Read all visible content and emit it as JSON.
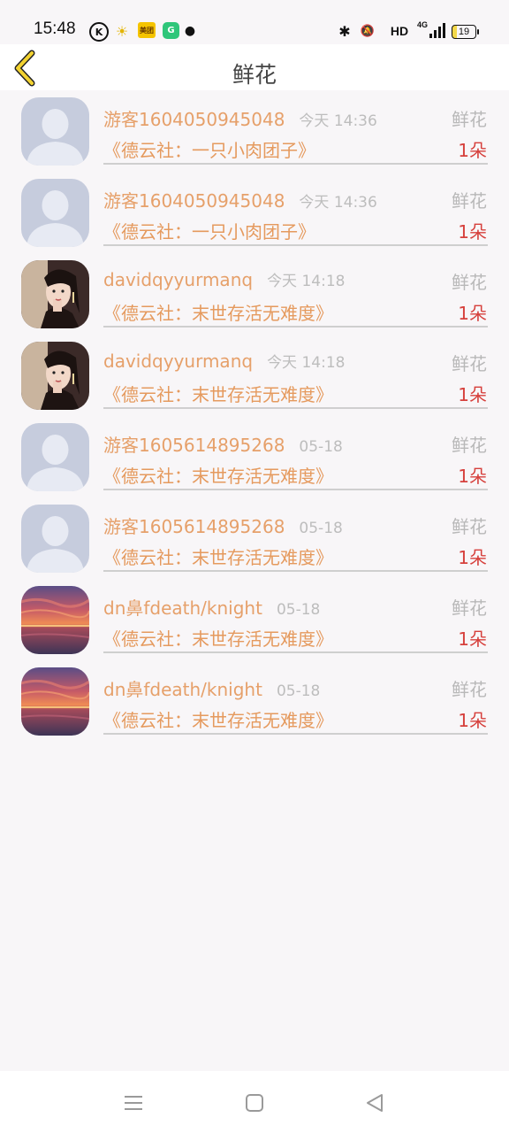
{
  "status_bar": {
    "time": "15:48",
    "icons": [
      "k-icon",
      "weather-icon",
      "app-icon",
      "app-icon",
      "dot-icon",
      "bluetooth-icon",
      "mute-icon",
      "hd-icon",
      "signal-icon",
      "battery-icon"
    ],
    "app1_label": "美团",
    "hd_label": "HD",
    "network_label": "4G",
    "battery_level": "19"
  },
  "header": {
    "title": "鲜花"
  },
  "list": [
    {
      "user": "游客1604050945048",
      "time": "今天 14:36",
      "type": "鲜花",
      "book": "《德云社：一只小肉团子》",
      "count": "1朵",
      "avatar": "default"
    },
    {
      "user": "游客1604050945048",
      "time": "今天 14:36",
      "type": "鲜花",
      "book": "《德云社：一只小肉团子》",
      "count": "1朵",
      "avatar": "default"
    },
    {
      "user": "davidqyyurmanq",
      "time": "今天 14:18",
      "type": "鲜花",
      "book": "《德云社：末世存活无难度》",
      "count": "1朵",
      "avatar": "portrait"
    },
    {
      "user": "davidqyyurmanq",
      "time": "今天 14:18",
      "type": "鲜花",
      "book": "《德云社：末世存活无难度》",
      "count": "1朵",
      "avatar": "portrait"
    },
    {
      "user": "游客1605614895268",
      "time": "05-18",
      "type": "鲜花",
      "book": "《德云社：末世存活无难度》",
      "count": "1朵",
      "avatar": "default"
    },
    {
      "user": "游客1605614895268",
      "time": "05-18",
      "type": "鲜花",
      "book": "《德云社：末世存活无难度》",
      "count": "1朵",
      "avatar": "default"
    },
    {
      "user": "dn鼻fdeath/knight",
      "time": "05-18",
      "type": "鲜花",
      "book": "《德云社：末世存活无难度》",
      "count": "1朵",
      "avatar": "sunset"
    },
    {
      "user": "dn鼻fdeath/knight",
      "time": "05-18",
      "type": "鲜花",
      "book": "《德云社：末世存活无难度》",
      "count": "1朵",
      "avatar": "sunset"
    }
  ],
  "colors": {
    "background": "#f8f6f8",
    "username": "#e6a06a",
    "book_title": "#e59a5e",
    "count": "#d6403c",
    "muted": "#b8b8b8",
    "back_arrow": "#f2d230"
  }
}
